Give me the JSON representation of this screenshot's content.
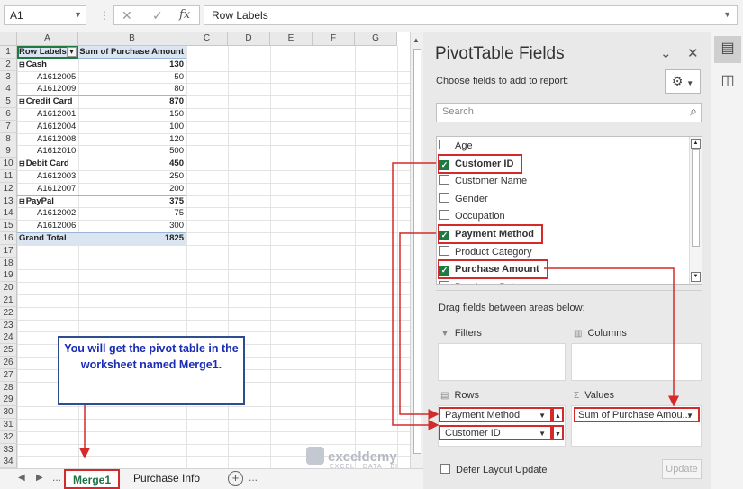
{
  "formula_bar": {
    "name_box": "A1",
    "cancel": "✕",
    "enter": "✓",
    "fx": "fx",
    "formula": "Row Labels"
  },
  "columns": [
    "A",
    "B",
    "C",
    "D",
    "E",
    "F",
    "G"
  ],
  "pivot_table": {
    "header": [
      "Row Labels",
      "Sum of Purchase Amount"
    ],
    "rows": [
      {
        "label": "Cash",
        "value": "130",
        "level": 0
      },
      {
        "label": "A1612005",
        "value": "50",
        "level": 1
      },
      {
        "label": "A1612009",
        "value": "80",
        "level": 1
      },
      {
        "label": "Credit Card",
        "value": "870",
        "level": 0
      },
      {
        "label": "A1612001",
        "value": "150",
        "level": 1
      },
      {
        "label": "A1612004",
        "value": "100",
        "level": 1
      },
      {
        "label": "A1612008",
        "value": "120",
        "level": 1
      },
      {
        "label": "A1612010",
        "value": "500",
        "level": 1
      },
      {
        "label": "Debit Card",
        "value": "450",
        "level": 0
      },
      {
        "label": "A1612003",
        "value": "250",
        "level": 1
      },
      {
        "label": "A1612007",
        "value": "200",
        "level": 1
      },
      {
        "label": "PayPal",
        "value": "375",
        "level": 0
      },
      {
        "label": "A1612002",
        "value": "75",
        "level": 1
      },
      {
        "label": "A1612006",
        "value": "300",
        "level": 1
      }
    ],
    "grand_total": {
      "label": "Grand Total",
      "value": "1825"
    }
  },
  "sheet_tabs": {
    "ellipsis": "...",
    "items": [
      "Merge1",
      "Purchase Info"
    ],
    "more": "..."
  },
  "callout_text": "You will get the pivot table in the worksheet named Merge1.",
  "pivot_pane": {
    "title": "PivotTable Fields",
    "choose_text": "Choose fields to add to report:",
    "search_placeholder": "Search",
    "fields": [
      {
        "name": "Age",
        "checked": false
      },
      {
        "name": "Customer ID",
        "checked": true
      },
      {
        "name": "Customer Name",
        "checked": false
      },
      {
        "name": "Gender",
        "checked": false
      },
      {
        "name": "Occupation",
        "checked": false
      },
      {
        "name": "Payment Method",
        "checked": true
      },
      {
        "name": "Product Category",
        "checked": false
      },
      {
        "name": "Purchase Amount",
        "checked": true
      },
      {
        "name": "Purchase Date",
        "checked": false
      }
    ],
    "drag_text": "Drag fields between areas below:",
    "areas": {
      "filters": "Filters",
      "columns": "Columns",
      "rows": "Rows",
      "values": "Values",
      "rows_items": [
        "Payment Method",
        "Customer ID"
      ],
      "values_items": [
        "Sum of Purchase Amou..."
      ]
    },
    "defer_label": "Defer Layout Update",
    "update_label": "Update"
  },
  "watermark": {
    "name": "exceldemy",
    "tagline": "EXCEL · DATA · BI"
  },
  "colors": {
    "accent_green": "#1d7a40",
    "highlight_red": "#d32b2b",
    "callout_blue": "#1a2cb5"
  }
}
